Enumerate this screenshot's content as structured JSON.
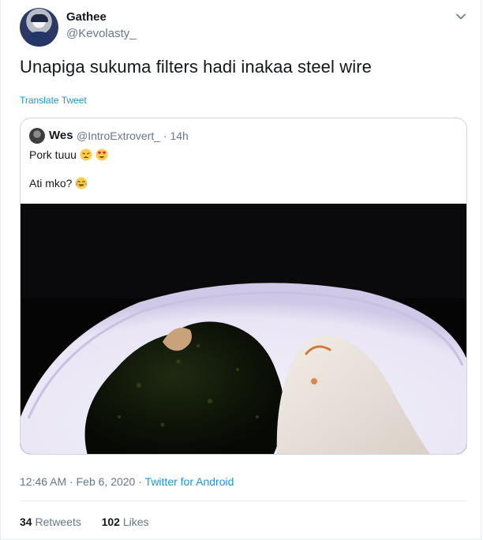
{
  "author": {
    "name": "Gathee",
    "handle": "@Kevolasty_"
  },
  "tweet": {
    "text": "Unapiga sukuma filters hadi inakaa steel wire",
    "translate_label": "Translate Tweet"
  },
  "quoted": {
    "name": "Wes",
    "handle": "@IntroExtrovert_",
    "separator": "·",
    "time": "14h",
    "line1": "Pork tuuu",
    "line2": "Ati mko?",
    "emojis_line1": [
      "weary-face-emoji",
      "heart-eyes-emoji"
    ],
    "emojis_line2": [
      "tears-of-joy-emoji"
    ],
    "photo": "plate of sukuma wiki and ugali"
  },
  "meta": {
    "time": "12:46 AM",
    "separator": "·",
    "date": "Feb 6, 2020",
    "source": "Twitter for Android"
  },
  "stats": {
    "retweets_count": "34",
    "retweets_label": "Retweets",
    "likes_count": "102",
    "likes_label": "Likes"
  },
  "icons": {
    "menu": "chevron-down-icon"
  },
  "colors": {
    "link": "#1b95e0",
    "secondary": "#657786",
    "primary_text": "#14171a",
    "border": "#ccd6dd"
  }
}
